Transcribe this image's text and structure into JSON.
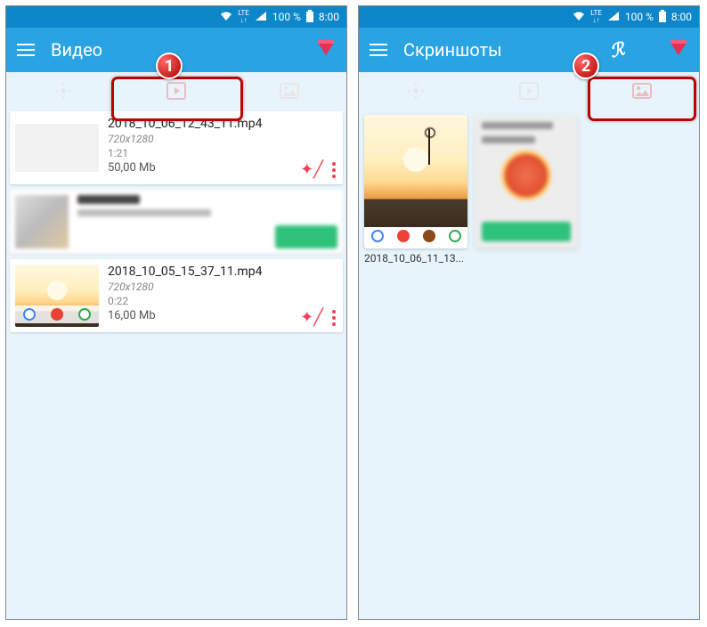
{
  "status": {
    "lte": "LTE",
    "battery": "100 %",
    "time": "8:00"
  },
  "screen1": {
    "title": "Видео",
    "badge": "1",
    "videos": [
      {
        "filename": "2018_10_06_12_43_11.mp4",
        "resolution": "720x1280",
        "duration": "1:21",
        "size": "50,00 Mb"
      },
      {
        "filename": "2018_10_05_15_37_11.mp4",
        "resolution": "720x1280",
        "duration": "0:22",
        "size": "16,00 Mb"
      }
    ]
  },
  "screen2": {
    "title": "Скриншоты",
    "badge": "2",
    "screenshots": [
      {
        "label": "2018_10_06_11_13..."
      }
    ]
  }
}
